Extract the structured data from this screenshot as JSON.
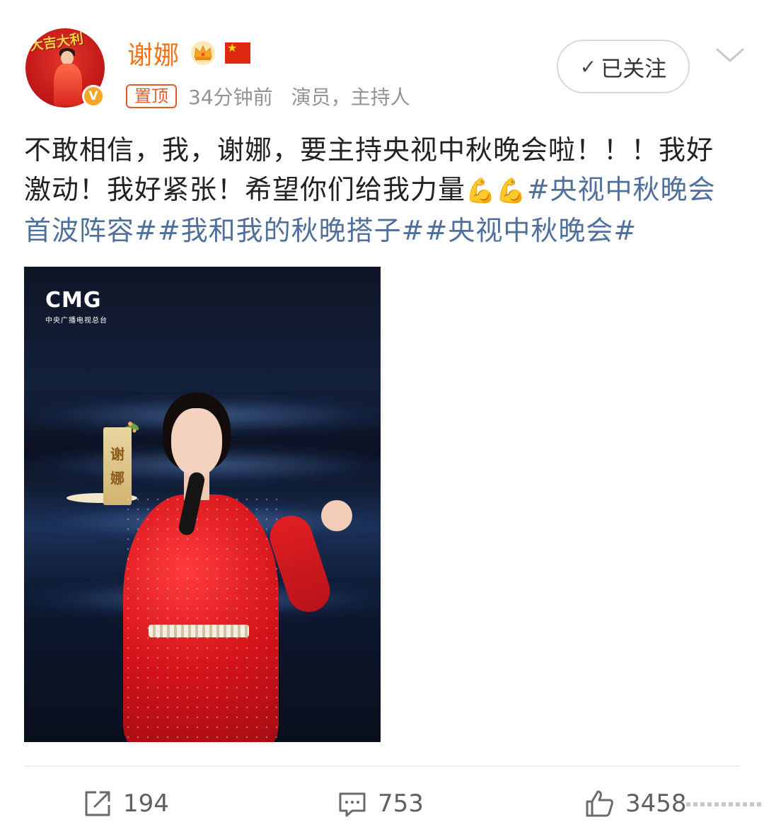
{
  "header": {
    "user_name": "谢娜",
    "pin_label": "置顶",
    "post_time": "34分钟前",
    "user_title": "演员，主持人",
    "follow_label": "已关注",
    "avatar_banner": "大吉大利",
    "verified_badge": "V",
    "icons": [
      "crown-icon",
      "china-flag-icon",
      "chevron-down-icon",
      "check-icon"
    ]
  },
  "post": {
    "text_main": "不敢相信，我，谢娜，要主持央视中秋晚会啦！！！我好激动！我好紧张！希望你们给我力量",
    "emoji": "💪💪",
    "hashtags": [
      "#央视中秋晚会首波阵容#",
      "#我和我的秋晚搭子#",
      "#央视中秋晚会#"
    ]
  },
  "image": {
    "logo_text": "CMG",
    "logo_subtext": "中央广播电视总台",
    "plaque_text": [
      "谢",
      "娜"
    ]
  },
  "actions": {
    "repost_count": "194",
    "comment_count": "753",
    "like_count": "3458",
    "icons": [
      "repost-icon",
      "comment-icon",
      "like-icon"
    ]
  },
  "colors": {
    "name_orange": "#f27216",
    "hashtag_blue": "#4f6f9c",
    "pin_red": "#e15b2c",
    "meta_gray": "#939393"
  }
}
